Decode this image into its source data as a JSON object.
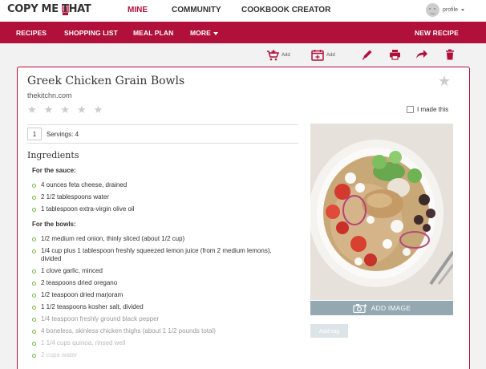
{
  "header": {
    "logo_text": "COPY ME THAT",
    "nav": {
      "mine": "MINE",
      "community": "COMMUNITY",
      "cookbook": "COOKBOOK CREATOR"
    },
    "profile_label": "profile"
  },
  "navbar": {
    "recipes": "RECIPES",
    "shopping_list": "SHOPPING LIST",
    "meal_plan": "MEAL PLAN",
    "more": "MORE",
    "new_recipe": "NEW RECIPE"
  },
  "toolbar": {
    "add_cart_label": "Add",
    "add_plan_label": "Add"
  },
  "recipe": {
    "title": "Greek Chicken Grain Bowls",
    "source": "thekitchn.com",
    "made_this_label": "I made this",
    "servings_value": "1",
    "servings_label": "Servings: 4",
    "ingredients_heading": "Ingredients",
    "sauce_label": "For the sauce:",
    "sauce_items": [
      "4 ounces feta cheese, drained",
      "2 1/2 tablespoons water",
      "1 tablespoon extra-virgin olive oil"
    ],
    "bowls_label": "For the bowls:",
    "bowls_items": [
      "1/2 medium red onion, thinly sliced (about 1/2 cup)",
      "1/4 cup plus 1 tablespoon freshly squeezed lemon juice (from 2 medium lemons), divided",
      "1 clove garlic, minced",
      "2 teaspoons dried oregano",
      "1/2 teaspoon dried marjoram",
      "1 1/2 teaspoons kosher salt, divided",
      "1/4 teaspoon freshly ground black pepper",
      "4 boneless, skinless chicken thighs (about 1 1/2 pounds total)",
      "1 1/4 cups quinoa, rinsed well",
      "2 cups water"
    ],
    "add_image_label": "ADD IMAGE",
    "add_tag_label": "Add tag"
  },
  "colors": {
    "brand": "#b0103a",
    "bullet": "#7ab648",
    "add_image_bg": "#93a8b0"
  },
  "icons": [
    "cart-add-icon",
    "calendar-add-icon",
    "pencil-icon",
    "printer-icon",
    "share-icon",
    "trash-icon",
    "star-icon",
    "camera-icon"
  ]
}
